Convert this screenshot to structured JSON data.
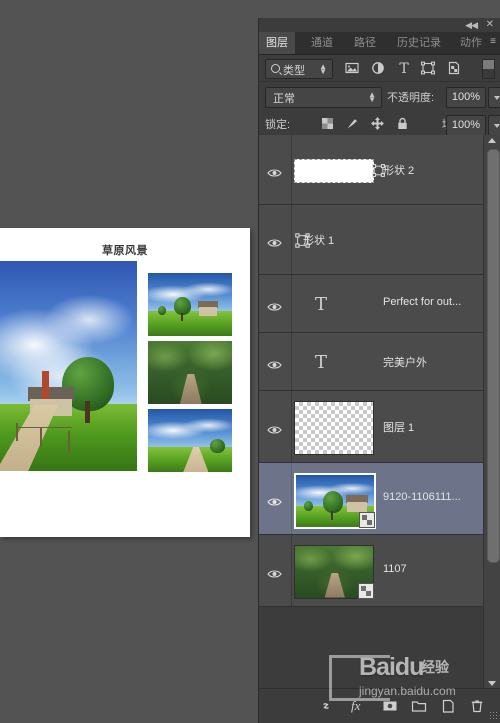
{
  "app": {
    "name": "photoshop-layers-panel"
  },
  "canvas": {
    "document_title": "草原风景",
    "hero_alt": "grassland-house-scene",
    "thumbs": [
      {
        "alt": "house-on-green-field"
      },
      {
        "alt": "forest-dirt-path"
      },
      {
        "alt": "blue-sky-country-road"
      }
    ]
  },
  "panel": {
    "window_controls": {
      "collapse": "◀◀",
      "close": "✕"
    },
    "tabs": [
      {
        "label": "图层",
        "active": true
      },
      {
        "label": "通道",
        "active": false
      },
      {
        "label": "路径",
        "active": false
      },
      {
        "label": "历史记录",
        "active": false
      },
      {
        "label": "动作",
        "active": false
      }
    ],
    "tab_menu": "≡",
    "filter": {
      "type_label": "类型",
      "icons": [
        "image-filter-icon",
        "adjustment-filter-icon",
        "text-filter-icon",
        "shape-filter-icon",
        "smartobject-filter-icon"
      ],
      "toggle": "filter-on-off-switch"
    },
    "blend": {
      "mode": "正常",
      "opacity_label": "不透明度:",
      "opacity_value": "100%",
      "fill_label": "填充:",
      "fill_value": "100%"
    },
    "lock": {
      "label": "锁定:",
      "icons": [
        "lock-transparency-icon",
        "lock-image-icon",
        "lock-position-icon",
        "lock-all-icon"
      ]
    },
    "layers": [
      {
        "name": "形状 2",
        "visible": true,
        "selected": false,
        "thumb": "white-rectangle-shape",
        "has_vector_mask": true,
        "has_smart_badge": false
      },
      {
        "name": "形状 1",
        "visible": true,
        "selected": false,
        "thumb": "vector-shape-outline",
        "has_vector_mask": false,
        "has_smart_badge": false
      },
      {
        "name": "Perfect for out...",
        "visible": true,
        "selected": false,
        "thumb": "text-layer-T",
        "has_vector_mask": false,
        "has_smart_badge": false
      },
      {
        "name": "完美户外",
        "visible": true,
        "selected": false,
        "thumb": "text-layer-T",
        "has_vector_mask": false,
        "has_smart_badge": false
      },
      {
        "name": "图层 1",
        "visible": true,
        "selected": false,
        "thumb": "transparent-checker",
        "has_vector_mask": false,
        "has_smart_badge": false
      },
      {
        "name": "9120-1106111...",
        "visible": true,
        "selected": true,
        "thumb": "house-on-green-field",
        "has_vector_mask": false,
        "has_smart_badge": true
      },
      {
        "name": "1107",
        "visible": true,
        "selected": false,
        "thumb": "forest-dirt-path",
        "has_vector_mask": false,
        "has_smart_badge": true
      }
    ],
    "bottom_bar": [
      "link-layers-icon",
      "fx-icon",
      "add-mask-icon",
      "new-group-icon",
      "new-layer-icon",
      "delete-layer-icon"
    ],
    "fx_label": "fx"
  },
  "watermark": {
    "brand": "Baidu",
    "suffix": "经验",
    "url": "jingyan.baidu.com"
  },
  "colors": {
    "background": "#535353",
    "panel": "#3c3c3c",
    "row": "#4b4b4b",
    "row_selected": "#6d7489",
    "text": "#e3e3e3"
  }
}
